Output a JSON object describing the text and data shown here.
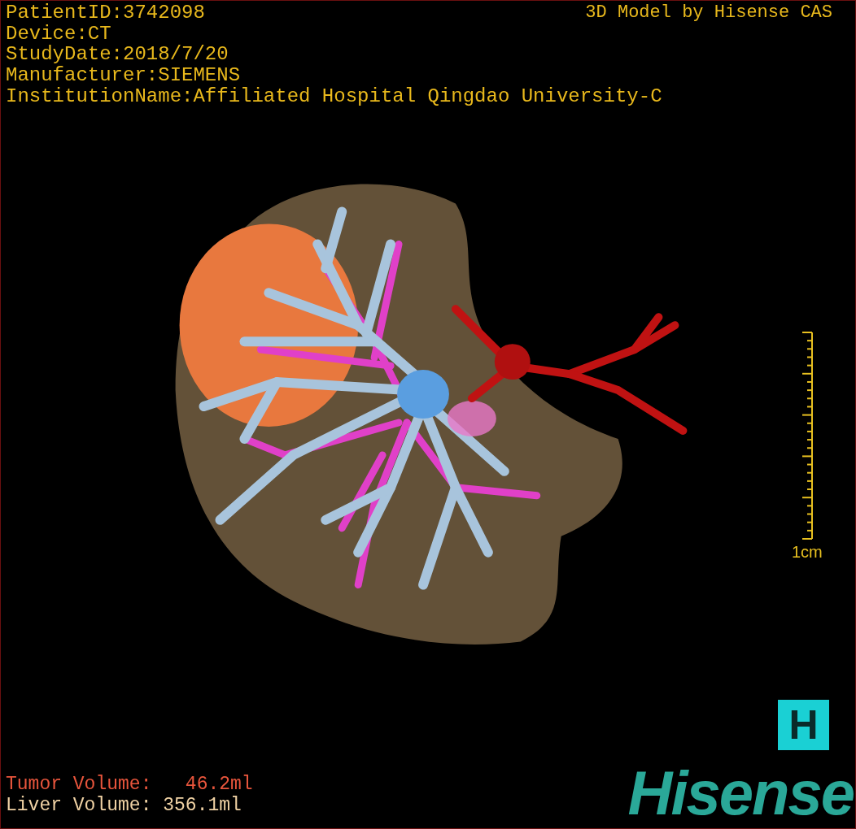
{
  "info_lines": [
    "PatientID:3742098",
    "Device:CT",
    "StudyDate:2018/7/20",
    "Manufacturer:SIEMENS",
    "InstitutionName:Affiliated Hospital Qingdao University-C"
  ],
  "title": "3D Model by Hisense CAS",
  "scale_bar": {
    "label": "1cm"
  },
  "volumes": [
    {
      "kind": "tumor",
      "label": "Tumor Volume:",
      "value": "  46.2ml"
    },
    {
      "kind": "liver",
      "label": "Liver Volume:",
      "value": "356.1ml"
    }
  ],
  "logo": {
    "badge": "H",
    "wordmark": "Hisense"
  }
}
